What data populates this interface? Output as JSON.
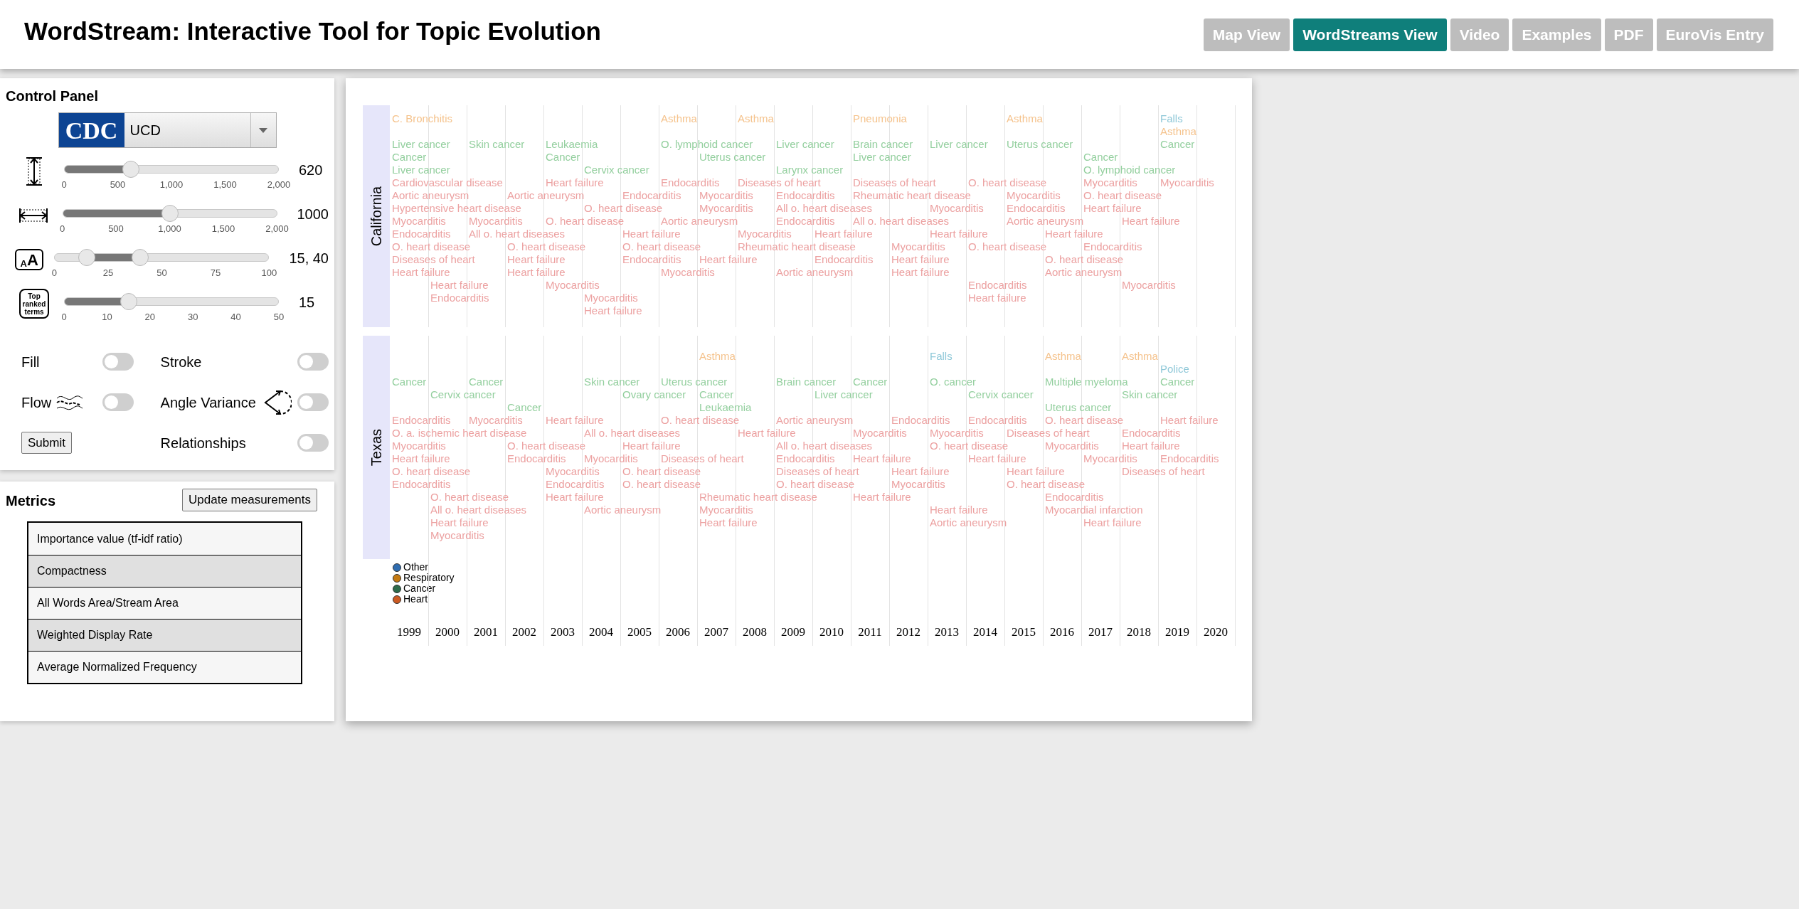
{
  "header": {
    "title": "WordStream: Interactive Tool for Topic Evolution",
    "nav": [
      {
        "label": "Map View",
        "selected": false
      },
      {
        "label": "WordStreams View",
        "selected": true
      },
      {
        "label": "Video",
        "selected": false
      },
      {
        "label": "Examples",
        "selected": false
      },
      {
        "label": "PDF",
        "selected": false
      },
      {
        "label": "EuroVis Entry",
        "selected": false
      }
    ]
  },
  "control_panel": {
    "title": "Control Panel",
    "source": {
      "logo_text": "CDC",
      "value": "UCD"
    },
    "sliders": [
      {
        "kind": "single",
        "thumbs": [
          {
            "level": 0.31
          }
        ],
        "ticks": [
          "0",
          "500",
          "1,000",
          "1,500",
          "2,000"
        ],
        "reading": "620"
      },
      {
        "kind": "single",
        "thumbs": [
          {
            "level": 0.5
          }
        ],
        "ticks": [
          "0",
          "500",
          "1,000",
          "1,500",
          "2,000"
        ],
        "reading": "1000"
      },
      {
        "icon_text": [
          "A",
          "A"
        ],
        "kind": "range",
        "thumbs": [
          {
            "level": 0.15
          },
          {
            "level": 0.4
          }
        ],
        "ticks": [
          "0",
          "25",
          "50",
          "75",
          "100"
        ],
        "reading": "15, 40"
      },
      {
        "icon_text": [
          "Top",
          "ranked",
          "terms"
        ],
        "kind": "single",
        "thumbs": [
          {
            "level": 0.3
          }
        ],
        "ticks": [
          "0",
          "10",
          "20",
          "30",
          "40",
          "50"
        ],
        "reading": "15"
      }
    ],
    "toggles": [
      {
        "label": "Fill",
        "on": false
      },
      {
        "label": "Stroke",
        "on": false
      },
      {
        "label": "Flow",
        "on": false
      },
      {
        "label": "Angle Variance",
        "on": false
      },
      {
        "label": "Relationships",
        "on": false
      }
    ],
    "submit": "Submit"
  },
  "metrics": {
    "title": "Metrics",
    "button": "Update measurements",
    "rows": [
      "Importance value (tf-idf ratio)",
      "Compactness",
      "All Words Area/Stream Area",
      "Weighted Display Rate",
      "Average Normalized Frequency"
    ]
  },
  "chart": {
    "streams": [
      {
        "name": "California",
        "columns": [
          [
            {
              "text": "C. Bronchitis",
              "kind": "respiratory"
            },
            {
              "text": "Liver cancer",
              "kind": "cancer"
            },
            {
              "text": "Cancer",
              "kind": "cancer"
            },
            {
              "text": "Liver cancer",
              "kind": "cancer"
            },
            {
              "text": "Cardiovascular disease",
              "kind": "heart"
            },
            {
              "text": "Aortic aneurysm",
              "kind": "heart"
            },
            {
              "text": "Hypertensive heart disease",
              "kind": "heart"
            },
            {
              "text": "Myocarditis",
              "kind": "heart"
            },
            {
              "text": "Endocarditis",
              "kind": "heart"
            },
            {
              "text": "O. heart disease",
              "kind": "heart"
            },
            {
              "text": "Diseases of heart",
              "kind": "heart"
            },
            {
              "text": "Heart failure",
              "kind": "heart"
            }
          ],
          [
            {
              "text": "Heart failure",
              "kind": "heart"
            },
            {
              "text": "Endocarditis",
              "kind": "heart"
            }
          ],
          [
            {
              "text": "Skin cancer",
              "kind": "cancer"
            },
            {
              "text": "Myocarditis",
              "kind": "heart"
            },
            {
              "text": "All o. heart diseases",
              "kind": "heart"
            }
          ],
          [
            {
              "text": "Aortic aneurysm",
              "kind": "heart"
            },
            {
              "text": "O. heart disease",
              "kind": "heart"
            },
            {
              "text": "Heart failure",
              "kind": "heart"
            },
            {
              "text": "Heart failure",
              "kind": "heart"
            }
          ],
          [
            {
              "text": "Leukaemia",
              "kind": "cancer"
            },
            {
              "text": "Cancer",
              "kind": "cancer"
            },
            {
              "text": "Heart failure",
              "kind": "heart"
            },
            {
              "text": "O. heart disease",
              "kind": "heart"
            },
            {
              "text": "Myocarditis",
              "kind": "heart"
            }
          ],
          [
            {
              "text": "Cervix cancer",
              "kind": "cancer"
            },
            {
              "text": "O. heart disease",
              "kind": "heart"
            },
            {
              "text": "Myocarditis",
              "kind": "heart"
            },
            {
              "text": "Heart failure",
              "kind": "heart"
            }
          ],
          [
            {
              "text": "Endocarditis",
              "kind": "heart"
            },
            {
              "text": "Heart failure",
              "kind": "heart"
            },
            {
              "text": "O. heart disease",
              "kind": "heart"
            },
            {
              "text": "Endocarditis",
              "kind": "heart"
            }
          ],
          [
            {
              "text": "Asthma",
              "kind": "respiratory"
            },
            {
              "text": "O. lymphoid cancer",
              "kind": "cancer"
            },
            {
              "text": "Endocarditis",
              "kind": "heart"
            },
            {
              "text": "Aortic aneurysm",
              "kind": "heart"
            },
            {
              "text": "Myocarditis",
              "kind": "heart"
            }
          ],
          [
            {
              "text": "Uterus cancer",
              "kind": "cancer"
            },
            {
              "text": "Myocarditis",
              "kind": "heart"
            },
            {
              "text": "Myocarditis",
              "kind": "heart"
            },
            {
              "text": "Heart failure",
              "kind": "heart"
            }
          ],
          [
            {
              "text": "Asthma",
              "kind": "respiratory"
            },
            {
              "text": "Diseases of heart",
              "kind": "heart"
            },
            {
              "text": "Myocarditis",
              "kind": "heart"
            },
            {
              "text": "Rheumatic heart disease",
              "kind": "heart"
            }
          ],
          [
            {
              "text": "Liver cancer",
              "kind": "cancer"
            },
            {
              "text": "Larynx cancer",
              "kind": "cancer"
            },
            {
              "text": "Endocarditis",
              "kind": "heart"
            },
            {
              "text": "All o. heart diseases",
              "kind": "heart"
            },
            {
              "text": "Endocarditis",
              "kind": "heart"
            },
            {
              "text": "Aortic aneurysm",
              "kind": "heart"
            }
          ],
          [
            {
              "text": "Heart failure",
              "kind": "heart"
            },
            {
              "text": "Endocarditis",
              "kind": "heart"
            }
          ],
          [
            {
              "text": "Pneumonia",
              "kind": "respiratory"
            },
            {
              "text": "Brain cancer",
              "kind": "cancer"
            },
            {
              "text": "Liver cancer",
              "kind": "cancer"
            },
            {
              "text": "Diseases of heart",
              "kind": "heart"
            },
            {
              "text": "Rheumatic heart disease",
              "kind": "heart"
            },
            {
              "text": "All o. heart diseases",
              "kind": "heart"
            }
          ],
          [
            {
              "text": "Myocarditis",
              "kind": "heart"
            },
            {
              "text": "Heart failure",
              "kind": "heart"
            },
            {
              "text": "Heart failure",
              "kind": "heart"
            }
          ],
          [
            {
              "text": "Liver cancer",
              "kind": "cancer"
            },
            {
              "text": "Myocarditis",
              "kind": "heart"
            },
            {
              "text": "Heart failure",
              "kind": "heart"
            }
          ],
          [
            {
              "text": "O. heart disease",
              "kind": "heart"
            },
            {
              "text": "O. heart disease",
              "kind": "heart"
            },
            {
              "text": "Endocarditis",
              "kind": "heart"
            },
            {
              "text": "Heart failure",
              "kind": "heart"
            }
          ],
          [
            {
              "text": "Asthma",
              "kind": "respiratory"
            },
            {
              "text": "Uterus cancer",
              "kind": "cancer"
            },
            {
              "text": "Myocarditis",
              "kind": "heart"
            },
            {
              "text": "Endocarditis",
              "kind": "heart"
            },
            {
              "text": "Aortic aneurysm",
              "kind": "heart"
            }
          ],
          [
            {
              "text": "Heart failure",
              "kind": "heart"
            },
            {
              "text": "O. heart disease",
              "kind": "heart"
            },
            {
              "text": "Aortic aneurysm",
              "kind": "heart"
            }
          ],
          [
            {
              "text": "Cancer",
              "kind": "cancer"
            },
            {
              "text": "O. lymphoid cancer",
              "kind": "cancer"
            },
            {
              "text": "Myocarditis",
              "kind": "heart"
            },
            {
              "text": "O. heart disease",
              "kind": "heart"
            },
            {
              "text": "Heart failure",
              "kind": "heart"
            },
            {
              "text": "Endocarditis",
              "kind": "heart"
            }
          ],
          [
            {
              "text": "Heart failure",
              "kind": "heart"
            },
            {
              "text": "Myocarditis",
              "kind": "heart"
            }
          ],
          [
            {
              "text": "Falls",
              "kind": "other"
            },
            {
              "text": "Asthma",
              "kind": "respiratory"
            },
            {
              "text": "Cancer",
              "kind": "cancer"
            },
            {
              "text": "Myocarditis",
              "kind": "heart"
            }
          ]
        ]
      },
      {
        "name": "Texas",
        "columns": [
          [
            {
              "text": "Cancer",
              "kind": "cancer"
            },
            {
              "text": "Endocarditis",
              "kind": "heart"
            },
            {
              "text": "O. a. ischemic heart disease",
              "kind": "heart"
            },
            {
              "text": "Myocarditis",
              "kind": "heart"
            },
            {
              "text": "Heart failure",
              "kind": "heart"
            },
            {
              "text": "O. heart disease",
              "kind": "heart"
            },
            {
              "text": "Endocarditis",
              "kind": "heart"
            }
          ],
          [
            {
              "text": "Cervix cancer",
              "kind": "cancer"
            },
            {
              "text": "O. heart disease",
              "kind": "heart"
            },
            {
              "text": "All o. heart diseases",
              "kind": "heart"
            },
            {
              "text": "Heart failure",
              "kind": "heart"
            },
            {
              "text": "Myocarditis",
              "kind": "heart"
            }
          ],
          [
            {
              "text": "Cancer",
              "kind": "cancer"
            },
            {
              "text": "Myocarditis",
              "kind": "heart"
            }
          ],
          [
            {
              "text": "Cancer",
              "kind": "cancer"
            },
            {
              "text": "O. heart disease",
              "kind": "heart"
            },
            {
              "text": "Endocarditis",
              "kind": "heart"
            }
          ],
          [
            {
              "text": "Heart failure",
              "kind": "heart"
            },
            {
              "text": "Myocarditis",
              "kind": "heart"
            },
            {
              "text": "Endocarditis",
              "kind": "heart"
            },
            {
              "text": "Heart failure",
              "kind": "heart"
            }
          ],
          [
            {
              "text": "Skin cancer",
              "kind": "cancer"
            },
            {
              "text": "All o. heart diseases",
              "kind": "heart"
            },
            {
              "text": "Myocarditis",
              "kind": "heart"
            },
            {
              "text": "Aortic aneurysm",
              "kind": "heart"
            }
          ],
          [
            {
              "text": "Ovary cancer",
              "kind": "cancer"
            },
            {
              "text": "Heart failure",
              "kind": "heart"
            },
            {
              "text": "O. heart disease",
              "kind": "heart"
            },
            {
              "text": "O. heart disease",
              "kind": "heart"
            }
          ],
          [
            {
              "text": "Uterus cancer",
              "kind": "cancer"
            },
            {
              "text": "O. heart disease",
              "kind": "heart"
            },
            {
              "text": "Diseases of heart",
              "kind": "heart"
            }
          ],
          [
            {
              "text": "Asthma",
              "kind": "respiratory"
            },
            {
              "text": "Cancer",
              "kind": "cancer"
            },
            {
              "text": "Leukaemia",
              "kind": "cancer"
            },
            {
              "text": "Rheumatic heart disease",
              "kind": "heart"
            },
            {
              "text": "Myocarditis",
              "kind": "heart"
            },
            {
              "text": "Heart failure",
              "kind": "heart"
            }
          ],
          [
            {
              "text": "Heart failure",
              "kind": "heart"
            }
          ],
          [
            {
              "text": "Brain cancer",
              "kind": "cancer"
            },
            {
              "text": "Aortic aneurysm",
              "kind": "heart"
            },
            {
              "text": "All o. heart diseases",
              "kind": "heart"
            },
            {
              "text": "Endocarditis",
              "kind": "heart"
            },
            {
              "text": "Diseases of heart",
              "kind": "heart"
            },
            {
              "text": "O. heart disease",
              "kind": "heart"
            }
          ],
          [
            {
              "text": "Liver cancer",
              "kind": "cancer"
            }
          ],
          [
            {
              "text": "Cancer",
              "kind": "cancer"
            },
            {
              "text": "Myocarditis",
              "kind": "heart"
            },
            {
              "text": "Heart failure",
              "kind": "heart"
            },
            {
              "text": "Heart failure",
              "kind": "heart"
            }
          ],
          [
            {
              "text": "Endocarditis",
              "kind": "heart"
            },
            {
              "text": "Heart failure",
              "kind": "heart"
            },
            {
              "text": "Myocarditis",
              "kind": "heart"
            }
          ],
          [
            {
              "text": "Falls",
              "kind": "other"
            },
            {
              "text": "O. cancer",
              "kind": "cancer"
            },
            {
              "text": "Myocarditis",
              "kind": "heart"
            },
            {
              "text": "O. heart disease",
              "kind": "heart"
            },
            {
              "text": "Heart failure",
              "kind": "heart"
            },
            {
              "text": "Aortic aneurysm",
              "kind": "heart"
            }
          ],
          [
            {
              "text": "Cervix cancer",
              "kind": "cancer"
            },
            {
              "text": "Endocarditis",
              "kind": "heart"
            },
            {
              "text": "Heart failure",
              "kind": "heart"
            }
          ],
          [
            {
              "text": "Diseases of heart",
              "kind": "heart"
            },
            {
              "text": "Heart failure",
              "kind": "heart"
            },
            {
              "text": "O. heart disease",
              "kind": "heart"
            }
          ],
          [
            {
              "text": "Asthma",
              "kind": "respiratory"
            },
            {
              "text": "Multiple myeloma",
              "kind": "cancer"
            },
            {
              "text": "Uterus cancer",
              "kind": "cancer"
            },
            {
              "text": "O. heart disease",
              "kind": "heart"
            },
            {
              "text": "Myocarditis",
              "kind": "heart"
            },
            {
              "text": "Endocarditis",
              "kind": "heart"
            },
            {
              "text": "Myocardial infarction",
              "kind": "heart"
            }
          ],
          [
            {
              "text": "Myocarditis",
              "kind": "heart"
            },
            {
              "text": "Heart failure",
              "kind": "heart"
            }
          ],
          [
            {
              "text": "Asthma",
              "kind": "respiratory"
            },
            {
              "text": "Skin cancer",
              "kind": "cancer"
            },
            {
              "text": "Endocarditis",
              "kind": "heart"
            },
            {
              "text": "Heart failure",
              "kind": "heart"
            },
            {
              "text": "Diseases of heart",
              "kind": "heart"
            }
          ],
          [
            {
              "text": "Police",
              "kind": "other"
            },
            {
              "text": "Cancer",
              "kind": "cancer"
            },
            {
              "text": "Heart failure",
              "kind": "heart"
            },
            {
              "text": "Endocarditis",
              "kind": "heart"
            }
          ]
        ]
      }
    ],
    "legend": [
      {
        "label": "Other",
        "color": "#2f6db0"
      },
      {
        "label": "Respiratory",
        "color": "#c47a12"
      },
      {
        "label": "Cancer",
        "color": "#2d6b4b"
      },
      {
        "label": "Heart",
        "color": "#cc5a22"
      }
    ],
    "years": [
      "1999",
      "2000",
      "2001",
      "2002",
      "2003",
      "2004",
      "2005",
      "2006",
      "2007",
      "2008",
      "2009",
      "2010",
      "2011",
      "2012",
      "2013",
      "2014",
      "2015",
      "2016",
      "2017",
      "2018",
      "2019",
      "2020"
    ]
  }
}
